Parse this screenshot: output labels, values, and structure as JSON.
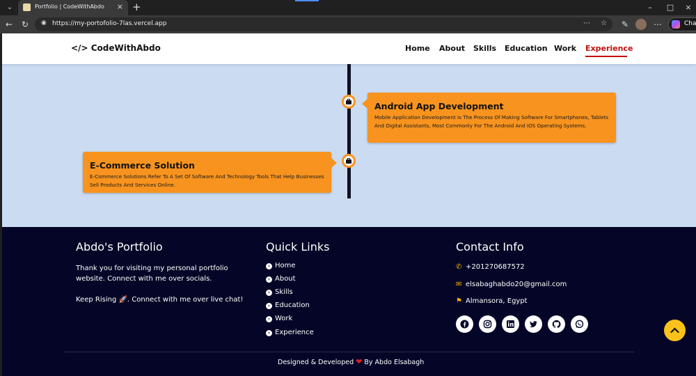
{
  "browser": {
    "tab_title": "Portfolio | CodeWithAbdo",
    "url": "https://my-portofolio-7las.vercel.app",
    "copilot_label": "Chat"
  },
  "nav": {
    "logo_text": "CodeWithAbdo",
    "links": [
      "Home",
      "About",
      "Skills",
      "Education",
      "Work",
      "Experience"
    ],
    "active": "Experience"
  },
  "timeline": {
    "items": [
      {
        "title": "Android App Development",
        "description": "Mobile Application Development Is The Process Of Making Software For Smartphones, Tablets And Digital Assistants, Most Commonly For The Android And IOS Operating Systems."
      },
      {
        "title": "E-Commerce Solution",
        "description": "E-Commerce Solutions Refer To A Set Of Software And Technology Tools That Help Businesses Sell Products And Services Online."
      }
    ]
  },
  "footer": {
    "about_title": "Abdo's Portfolio",
    "about_text": "Thank you for visiting my personal portfolio website. Connect with me over socials.",
    "about_text2": "Keep Rising 🚀. Connect with me over live chat!",
    "links_title": "Quick Links",
    "links": [
      "Home",
      "About",
      "Skills",
      "Education",
      "Work",
      "Experience"
    ],
    "contact_title": "Contact Info",
    "phone": "+201270687572",
    "email": "elsabaghabdo20@gmail.com",
    "location": "Almansora, Egypt",
    "socials": [
      "facebook-icon",
      "instagram-icon",
      "linkedin-icon",
      "twitter-icon",
      "github-icon",
      "whatsapp-icon"
    ],
    "credit_prefix": "Designed & Developed",
    "credit_suffix": "By Abdo Elsabagh"
  },
  "colors": {
    "accent": "#f7931e",
    "nav_active": "#c10f0f",
    "footer_bg": "#050627",
    "page_bg": "#cbdcf2",
    "contact_icon": "#f5b400",
    "scroll_top": "#fbc21a"
  }
}
